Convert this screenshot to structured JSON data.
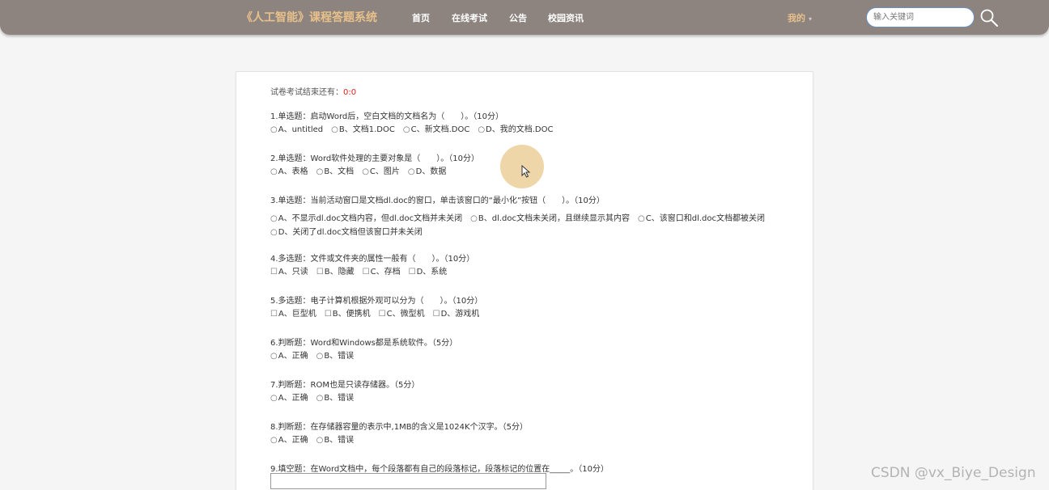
{
  "nav": {
    "brand": "《人工智能》课程答题系统",
    "items": [
      "首页",
      "在线考试",
      "公告",
      "校园资讯"
    ],
    "user": "我的",
    "search_placeholder": "输入关键词"
  },
  "exam": {
    "status_label": "试卷考试结束还有：",
    "countdown": "0:0",
    "questions": [
      {
        "title": "1.单选题：启动Word后，空白文档的文档名为（　　）。（10分）",
        "type": "radio",
        "options": [
          "A、untitled",
          "B、文档1.DOC",
          "C、新文档.DOC",
          "D、我的文档.DOC"
        ]
      },
      {
        "title": "2.单选题：Word软件处理的主要对象是（　　）。（10分）",
        "type": "radio",
        "options": [
          "A、表格",
          "B、文档",
          "C、图片",
          "D、数据"
        ]
      },
      {
        "title": "3.单选题：当前活动窗口是文档dl.doc的窗口，单击该窗口的“最小化”按钮（　　）。（10分）",
        "type": "radio",
        "options": [
          "A、不显示dl.doc文档内容，但dl.doc文档并未关闭",
          "B、dl.doc文档未关闭，且继续显示其内容",
          "C、该窗口和dl.doc文档都被关闭",
          "D、关闭了dl.doc文档但该窗口并未关闭"
        ]
      },
      {
        "title": "4.多选题：文件或文件夹的属性一般有（　　）。（10分）",
        "type": "checkbox",
        "options": [
          "A、只读",
          "B、隐藏",
          "C、存档",
          "D、系统"
        ]
      },
      {
        "title": "5.多选题：电子计算机根据外观可以分为（　　）。（10分）",
        "type": "checkbox",
        "options": [
          "A、巨型机",
          "B、便携机",
          "C、微型机",
          "D、游戏机"
        ]
      },
      {
        "title": "6.判断题：Word和Windows都是系统软件。（5分）",
        "type": "radio",
        "options": [
          "A、正确",
          "B、错误"
        ]
      },
      {
        "title": "7.判断题：ROM也是只读存储器。（5分）",
        "type": "radio",
        "options": [
          "A、正确",
          "B、错误"
        ]
      },
      {
        "title": "8.判断题：在存储器容量的表示中,1MB的含义是1024K个汉字。（5分）",
        "type": "radio",
        "options": [
          "A、正确",
          "B、错误"
        ]
      },
      {
        "title": "9.填空题：在Word文档中，每个段落都有自己的段落标记，段落标记的位置在_____。（10分）",
        "type": "fill",
        "options": []
      }
    ]
  },
  "watermark": "CSDN @vx_Biye_Design",
  "colors": {
    "nav_bg": "#8d8480",
    "brand": "#e8c08a",
    "countdown": "#d9221b"
  }
}
